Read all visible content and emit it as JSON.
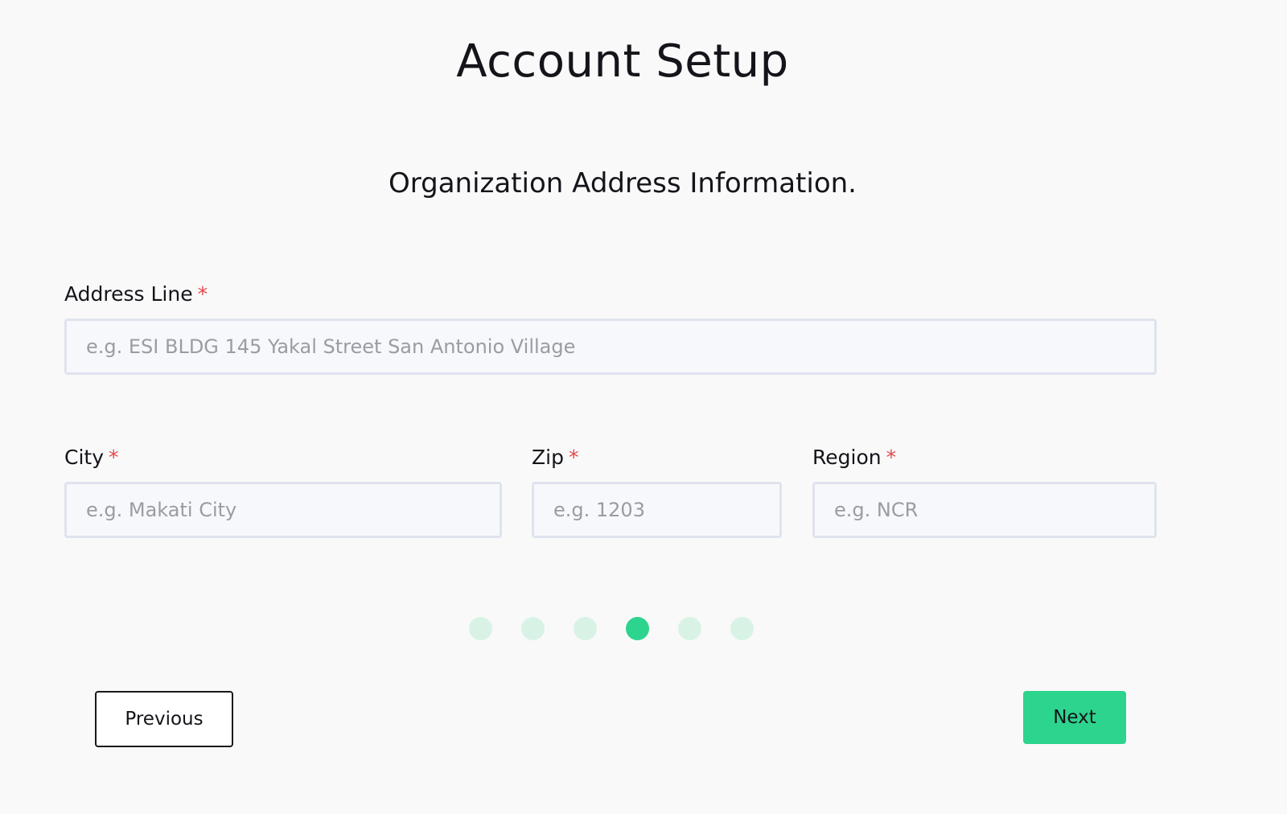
{
  "header": {
    "title": "Account Setup",
    "subtitle": "Organization Address Information."
  },
  "form": {
    "required_marker": "*",
    "address": {
      "label": "Address Line",
      "placeholder": "e.g. ESI BLDG 145 Yakal Street San Antonio Village",
      "value": ""
    },
    "city": {
      "label": "City",
      "placeholder": "e.g. Makati City",
      "value": ""
    },
    "zip": {
      "label": "Zip",
      "placeholder": "e.g. 1203",
      "value": ""
    },
    "region": {
      "label": "Region",
      "placeholder": "e.g. NCR",
      "value": ""
    }
  },
  "stepper": {
    "total_steps": 6,
    "current_step": 4
  },
  "navigation": {
    "previous_label": "Previous",
    "next_label": "Next"
  },
  "colors": {
    "accent": "#2dd48e",
    "step_inactive": "#d8f3e6",
    "required": "#e5484d",
    "input_border": "#dfe3ee",
    "input_bg": "#f7f8fc",
    "page_bg": "#f9f9f9"
  }
}
